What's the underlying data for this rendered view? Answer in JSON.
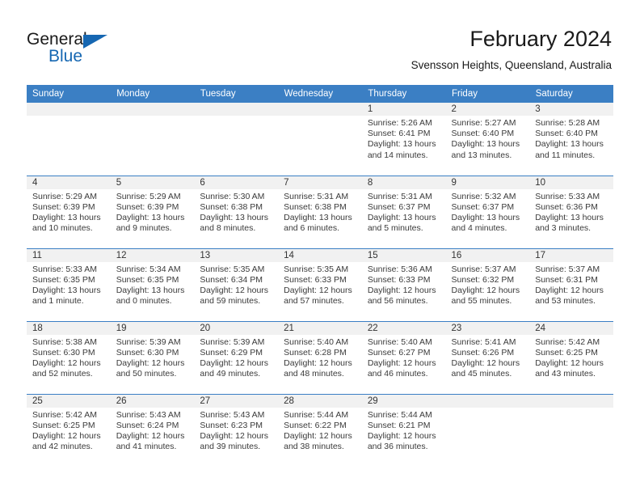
{
  "brand": {
    "name_part1": "General",
    "name_part2": "Blue",
    "triangle_color": "#1667b2"
  },
  "header": {
    "month_title": "February 2024",
    "location": "Svensson Heights, Queensland, Australia",
    "header_bg": "#3b7fc4",
    "daynum_bg": "#f1f1f1"
  },
  "weekdays": [
    "Sunday",
    "Monday",
    "Tuesday",
    "Wednesday",
    "Thursday",
    "Friday",
    "Saturday"
  ],
  "labels": {
    "sunrise_prefix": "Sunrise:",
    "sunset_prefix": "Sunset:",
    "daylight_prefix": "Daylight:"
  },
  "weeks": [
    [
      {
        "day": "",
        "sunrise": "",
        "sunset": "",
        "daylight_a": "",
        "daylight_b": ""
      },
      {
        "day": "",
        "sunrise": "",
        "sunset": "",
        "daylight_a": "",
        "daylight_b": ""
      },
      {
        "day": "",
        "sunrise": "",
        "sunset": "",
        "daylight_a": "",
        "daylight_b": ""
      },
      {
        "day": "",
        "sunrise": "",
        "sunset": "",
        "daylight_a": "",
        "daylight_b": ""
      },
      {
        "day": "1",
        "sunrise": "Sunrise: 5:26 AM",
        "sunset": "Sunset: 6:41 PM",
        "daylight_a": "Daylight: 13 hours",
        "daylight_b": "and 14 minutes."
      },
      {
        "day": "2",
        "sunrise": "Sunrise: 5:27 AM",
        "sunset": "Sunset: 6:40 PM",
        "daylight_a": "Daylight: 13 hours",
        "daylight_b": "and 13 minutes."
      },
      {
        "day": "3",
        "sunrise": "Sunrise: 5:28 AM",
        "sunset": "Sunset: 6:40 PM",
        "daylight_a": "Daylight: 13 hours",
        "daylight_b": "and 11 minutes."
      }
    ],
    [
      {
        "day": "4",
        "sunrise": "Sunrise: 5:29 AM",
        "sunset": "Sunset: 6:39 PM",
        "daylight_a": "Daylight: 13 hours",
        "daylight_b": "and 10 minutes."
      },
      {
        "day": "5",
        "sunrise": "Sunrise: 5:29 AM",
        "sunset": "Sunset: 6:39 PM",
        "daylight_a": "Daylight: 13 hours",
        "daylight_b": "and 9 minutes."
      },
      {
        "day": "6",
        "sunrise": "Sunrise: 5:30 AM",
        "sunset": "Sunset: 6:38 PM",
        "daylight_a": "Daylight: 13 hours",
        "daylight_b": "and 8 minutes."
      },
      {
        "day": "7",
        "sunrise": "Sunrise: 5:31 AM",
        "sunset": "Sunset: 6:38 PM",
        "daylight_a": "Daylight: 13 hours",
        "daylight_b": "and 6 minutes."
      },
      {
        "day": "8",
        "sunrise": "Sunrise: 5:31 AM",
        "sunset": "Sunset: 6:37 PM",
        "daylight_a": "Daylight: 13 hours",
        "daylight_b": "and 5 minutes."
      },
      {
        "day": "9",
        "sunrise": "Sunrise: 5:32 AM",
        "sunset": "Sunset: 6:37 PM",
        "daylight_a": "Daylight: 13 hours",
        "daylight_b": "and 4 minutes."
      },
      {
        "day": "10",
        "sunrise": "Sunrise: 5:33 AM",
        "sunset": "Sunset: 6:36 PM",
        "daylight_a": "Daylight: 13 hours",
        "daylight_b": "and 3 minutes."
      }
    ],
    [
      {
        "day": "11",
        "sunrise": "Sunrise: 5:33 AM",
        "sunset": "Sunset: 6:35 PM",
        "daylight_a": "Daylight: 13 hours",
        "daylight_b": "and 1 minute."
      },
      {
        "day": "12",
        "sunrise": "Sunrise: 5:34 AM",
        "sunset": "Sunset: 6:35 PM",
        "daylight_a": "Daylight: 13 hours",
        "daylight_b": "and 0 minutes."
      },
      {
        "day": "13",
        "sunrise": "Sunrise: 5:35 AM",
        "sunset": "Sunset: 6:34 PM",
        "daylight_a": "Daylight: 12 hours",
        "daylight_b": "and 59 minutes."
      },
      {
        "day": "14",
        "sunrise": "Sunrise: 5:35 AM",
        "sunset": "Sunset: 6:33 PM",
        "daylight_a": "Daylight: 12 hours",
        "daylight_b": "and 57 minutes."
      },
      {
        "day": "15",
        "sunrise": "Sunrise: 5:36 AM",
        "sunset": "Sunset: 6:33 PM",
        "daylight_a": "Daylight: 12 hours",
        "daylight_b": "and 56 minutes."
      },
      {
        "day": "16",
        "sunrise": "Sunrise: 5:37 AM",
        "sunset": "Sunset: 6:32 PM",
        "daylight_a": "Daylight: 12 hours",
        "daylight_b": "and 55 minutes."
      },
      {
        "day": "17",
        "sunrise": "Sunrise: 5:37 AM",
        "sunset": "Sunset: 6:31 PM",
        "daylight_a": "Daylight: 12 hours",
        "daylight_b": "and 53 minutes."
      }
    ],
    [
      {
        "day": "18",
        "sunrise": "Sunrise: 5:38 AM",
        "sunset": "Sunset: 6:30 PM",
        "daylight_a": "Daylight: 12 hours",
        "daylight_b": "and 52 minutes."
      },
      {
        "day": "19",
        "sunrise": "Sunrise: 5:39 AM",
        "sunset": "Sunset: 6:30 PM",
        "daylight_a": "Daylight: 12 hours",
        "daylight_b": "and 50 minutes."
      },
      {
        "day": "20",
        "sunrise": "Sunrise: 5:39 AM",
        "sunset": "Sunset: 6:29 PM",
        "daylight_a": "Daylight: 12 hours",
        "daylight_b": "and 49 minutes."
      },
      {
        "day": "21",
        "sunrise": "Sunrise: 5:40 AM",
        "sunset": "Sunset: 6:28 PM",
        "daylight_a": "Daylight: 12 hours",
        "daylight_b": "and 48 minutes."
      },
      {
        "day": "22",
        "sunrise": "Sunrise: 5:40 AM",
        "sunset": "Sunset: 6:27 PM",
        "daylight_a": "Daylight: 12 hours",
        "daylight_b": "and 46 minutes."
      },
      {
        "day": "23",
        "sunrise": "Sunrise: 5:41 AM",
        "sunset": "Sunset: 6:26 PM",
        "daylight_a": "Daylight: 12 hours",
        "daylight_b": "and 45 minutes."
      },
      {
        "day": "24",
        "sunrise": "Sunrise: 5:42 AM",
        "sunset": "Sunset: 6:25 PM",
        "daylight_a": "Daylight: 12 hours",
        "daylight_b": "and 43 minutes."
      }
    ],
    [
      {
        "day": "25",
        "sunrise": "Sunrise: 5:42 AM",
        "sunset": "Sunset: 6:25 PM",
        "daylight_a": "Daylight: 12 hours",
        "daylight_b": "and 42 minutes."
      },
      {
        "day": "26",
        "sunrise": "Sunrise: 5:43 AM",
        "sunset": "Sunset: 6:24 PM",
        "daylight_a": "Daylight: 12 hours",
        "daylight_b": "and 41 minutes."
      },
      {
        "day": "27",
        "sunrise": "Sunrise: 5:43 AM",
        "sunset": "Sunset: 6:23 PM",
        "daylight_a": "Daylight: 12 hours",
        "daylight_b": "and 39 minutes."
      },
      {
        "day": "28",
        "sunrise": "Sunrise: 5:44 AM",
        "sunset": "Sunset: 6:22 PM",
        "daylight_a": "Daylight: 12 hours",
        "daylight_b": "and 38 minutes."
      },
      {
        "day": "29",
        "sunrise": "Sunrise: 5:44 AM",
        "sunset": "Sunset: 6:21 PM",
        "daylight_a": "Daylight: 12 hours",
        "daylight_b": "and 36 minutes."
      },
      {
        "day": "",
        "sunrise": "",
        "sunset": "",
        "daylight_a": "",
        "daylight_b": ""
      },
      {
        "day": "",
        "sunrise": "",
        "sunset": "",
        "daylight_a": "",
        "daylight_b": ""
      }
    ]
  ]
}
